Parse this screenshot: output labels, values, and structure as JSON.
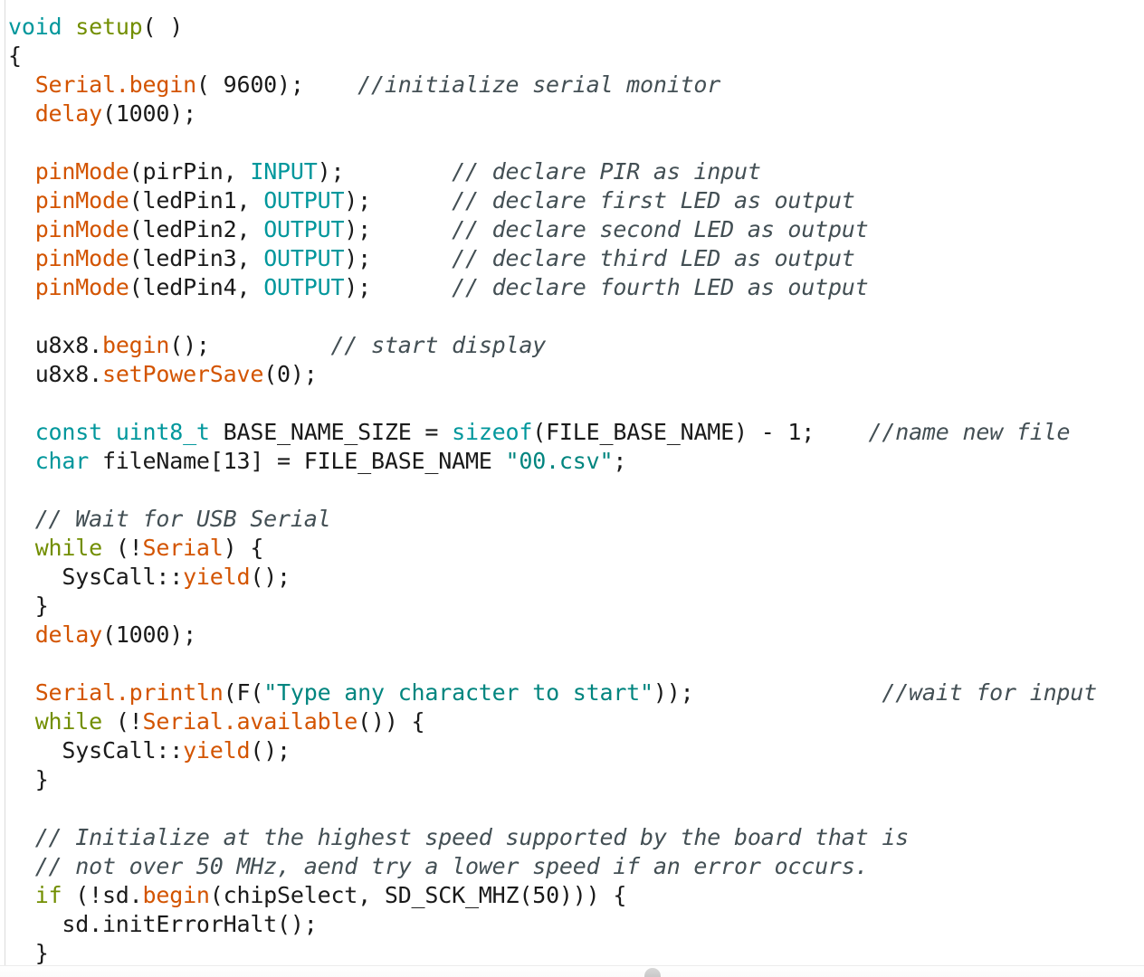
{
  "editor": {
    "language": "arduino-cpp",
    "colors": {
      "background": "#ffffff",
      "plain": "#1a1a1a",
      "type": "#00979c",
      "constant": "#00979c",
      "string": "#00857f",
      "function": "#d35400",
      "keyword": "#728e00",
      "comment": "#434f54",
      "gutter_rule": "#dcdcdc",
      "scroll_nub": "#c9c9c9"
    },
    "scroll_nub_name": "scroll-handle"
  },
  "lines": [
    {
      "n": 1,
      "tokens": [
        {
          "t": "void",
          "k": "type"
        },
        {
          "t": " ",
          "k": "plain"
        },
        {
          "t": "setup",
          "k": "keyword"
        },
        {
          "t": "( )",
          "k": "plain"
        }
      ]
    },
    {
      "n": 2,
      "tokens": [
        {
          "t": "{",
          "k": "plain"
        }
      ]
    },
    {
      "n": 3,
      "tokens": [
        {
          "t": "  ",
          "k": "plain"
        },
        {
          "t": "Serial.begin",
          "k": "func"
        },
        {
          "t": "( 9600);    ",
          "k": "plain"
        },
        {
          "t": "//initialize serial monitor",
          "k": "comment"
        }
      ]
    },
    {
      "n": 4,
      "tokens": [
        {
          "t": "  ",
          "k": "plain"
        },
        {
          "t": "delay",
          "k": "func"
        },
        {
          "t": "(1000);",
          "k": "plain"
        }
      ]
    },
    {
      "n": 5,
      "tokens": [
        {
          "t": "",
          "k": "plain"
        }
      ]
    },
    {
      "n": 6,
      "tokens": [
        {
          "t": "  ",
          "k": "plain"
        },
        {
          "t": "pinMode",
          "k": "func"
        },
        {
          "t": "(pirPin, ",
          "k": "plain"
        },
        {
          "t": "INPUT",
          "k": "const"
        },
        {
          "t": ");        ",
          "k": "plain"
        },
        {
          "t": "// declare PIR as input",
          "k": "comment"
        }
      ]
    },
    {
      "n": 7,
      "tokens": [
        {
          "t": "  ",
          "k": "plain"
        },
        {
          "t": "pinMode",
          "k": "func"
        },
        {
          "t": "(ledPin1, ",
          "k": "plain"
        },
        {
          "t": "OUTPUT",
          "k": "const"
        },
        {
          "t": ");      ",
          "k": "plain"
        },
        {
          "t": "// declare first LED as output",
          "k": "comment"
        }
      ]
    },
    {
      "n": 8,
      "tokens": [
        {
          "t": "  ",
          "k": "plain"
        },
        {
          "t": "pinMode",
          "k": "func"
        },
        {
          "t": "(ledPin2, ",
          "k": "plain"
        },
        {
          "t": "OUTPUT",
          "k": "const"
        },
        {
          "t": ");      ",
          "k": "plain"
        },
        {
          "t": "// declare second LED as output",
          "k": "comment"
        }
      ]
    },
    {
      "n": 9,
      "tokens": [
        {
          "t": "  ",
          "k": "plain"
        },
        {
          "t": "pinMode",
          "k": "func"
        },
        {
          "t": "(ledPin3, ",
          "k": "plain"
        },
        {
          "t": "OUTPUT",
          "k": "const"
        },
        {
          "t": ");      ",
          "k": "plain"
        },
        {
          "t": "// declare third LED as output",
          "k": "comment"
        }
      ]
    },
    {
      "n": 10,
      "tokens": [
        {
          "t": "  ",
          "k": "plain"
        },
        {
          "t": "pinMode",
          "k": "func"
        },
        {
          "t": "(ledPin4, ",
          "k": "plain"
        },
        {
          "t": "OUTPUT",
          "k": "const"
        },
        {
          "t": ");      ",
          "k": "plain"
        },
        {
          "t": "// declare fourth LED as output",
          "k": "comment"
        }
      ]
    },
    {
      "n": 11,
      "tokens": [
        {
          "t": "",
          "k": "plain"
        }
      ]
    },
    {
      "n": 12,
      "tokens": [
        {
          "t": "  u8x8.",
          "k": "plain"
        },
        {
          "t": "begin",
          "k": "func"
        },
        {
          "t": "();         ",
          "k": "plain"
        },
        {
          "t": "// start display",
          "k": "comment"
        }
      ]
    },
    {
      "n": 13,
      "tokens": [
        {
          "t": "  u8x8.",
          "k": "plain"
        },
        {
          "t": "setPowerSave",
          "k": "func"
        },
        {
          "t": "(0);",
          "k": "plain"
        }
      ]
    },
    {
      "n": 14,
      "tokens": [
        {
          "t": "",
          "k": "plain"
        }
      ]
    },
    {
      "n": 15,
      "tokens": [
        {
          "t": "  ",
          "k": "plain"
        },
        {
          "t": "const",
          "k": "type"
        },
        {
          "t": " ",
          "k": "plain"
        },
        {
          "t": "uint8_t",
          "k": "type"
        },
        {
          "t": " BASE_NAME_SIZE = ",
          "k": "plain"
        },
        {
          "t": "sizeof",
          "k": "type"
        },
        {
          "t": "(FILE_BASE_NAME) - 1;    ",
          "k": "plain"
        },
        {
          "t": "//name new file",
          "k": "comment"
        }
      ]
    },
    {
      "n": 16,
      "tokens": [
        {
          "t": "  ",
          "k": "plain"
        },
        {
          "t": "char",
          "k": "type"
        },
        {
          "t": " fileName[13] = FILE_BASE_NAME ",
          "k": "plain"
        },
        {
          "t": "\"00.csv\"",
          "k": "string"
        },
        {
          "t": ";",
          "k": "plain"
        }
      ]
    },
    {
      "n": 17,
      "tokens": [
        {
          "t": "",
          "k": "plain"
        }
      ]
    },
    {
      "n": 18,
      "tokens": [
        {
          "t": "  ",
          "k": "plain"
        },
        {
          "t": "// Wait for USB Serial",
          "k": "comment"
        }
      ]
    },
    {
      "n": 19,
      "tokens": [
        {
          "t": "  ",
          "k": "plain"
        },
        {
          "t": "while",
          "k": "keyword"
        },
        {
          "t": " (!",
          "k": "plain"
        },
        {
          "t": "Serial",
          "k": "func"
        },
        {
          "t": ") {",
          "k": "plain"
        }
      ]
    },
    {
      "n": 20,
      "tokens": [
        {
          "t": "    SysCall::",
          "k": "plain"
        },
        {
          "t": "yield",
          "k": "func"
        },
        {
          "t": "();",
          "k": "plain"
        }
      ]
    },
    {
      "n": 21,
      "tokens": [
        {
          "t": "  }",
          "k": "plain"
        }
      ]
    },
    {
      "n": 22,
      "tokens": [
        {
          "t": "  ",
          "k": "plain"
        },
        {
          "t": "delay",
          "k": "func"
        },
        {
          "t": "(1000);",
          "k": "plain"
        }
      ]
    },
    {
      "n": 23,
      "tokens": [
        {
          "t": "",
          "k": "plain"
        }
      ]
    },
    {
      "n": 24,
      "tokens": [
        {
          "t": "  ",
          "k": "plain"
        },
        {
          "t": "Serial.println",
          "k": "func"
        },
        {
          "t": "(F(",
          "k": "plain"
        },
        {
          "t": "\"Type any character to start\"",
          "k": "string"
        },
        {
          "t": "));              ",
          "k": "plain"
        },
        {
          "t": "//wait for input",
          "k": "comment"
        }
      ]
    },
    {
      "n": 25,
      "tokens": [
        {
          "t": "  ",
          "k": "plain"
        },
        {
          "t": "while",
          "k": "keyword"
        },
        {
          "t": " (!",
          "k": "plain"
        },
        {
          "t": "Serial.available",
          "k": "func"
        },
        {
          "t": "()) {",
          "k": "plain"
        }
      ]
    },
    {
      "n": 26,
      "tokens": [
        {
          "t": "    SysCall::",
          "k": "plain"
        },
        {
          "t": "yield",
          "k": "func"
        },
        {
          "t": "();",
          "k": "plain"
        }
      ]
    },
    {
      "n": 27,
      "tokens": [
        {
          "t": "  }",
          "k": "plain"
        }
      ]
    },
    {
      "n": 28,
      "tokens": [
        {
          "t": "",
          "k": "plain"
        }
      ]
    },
    {
      "n": 29,
      "tokens": [
        {
          "t": "  ",
          "k": "plain"
        },
        {
          "t": "// Initialize at the highest speed supported by the board that is",
          "k": "comment"
        }
      ]
    },
    {
      "n": 30,
      "tokens": [
        {
          "t": "  ",
          "k": "plain"
        },
        {
          "t": "// not over 50 MHz, aend try a lower speed if an error occurs.",
          "k": "comment"
        }
      ]
    },
    {
      "n": 31,
      "tokens": [
        {
          "t": "  ",
          "k": "plain"
        },
        {
          "t": "if",
          "k": "keyword"
        },
        {
          "t": " (!sd.",
          "k": "plain"
        },
        {
          "t": "begin",
          "k": "func"
        },
        {
          "t": "(chipSelect, SD_SCK_MHZ(50))) {",
          "k": "plain"
        }
      ]
    },
    {
      "n": 32,
      "tokens": [
        {
          "t": "    sd.initErrorHalt();",
          "k": "plain"
        }
      ]
    },
    {
      "n": 33,
      "tokens": [
        {
          "t": "  }",
          "k": "plain"
        }
      ]
    }
  ]
}
